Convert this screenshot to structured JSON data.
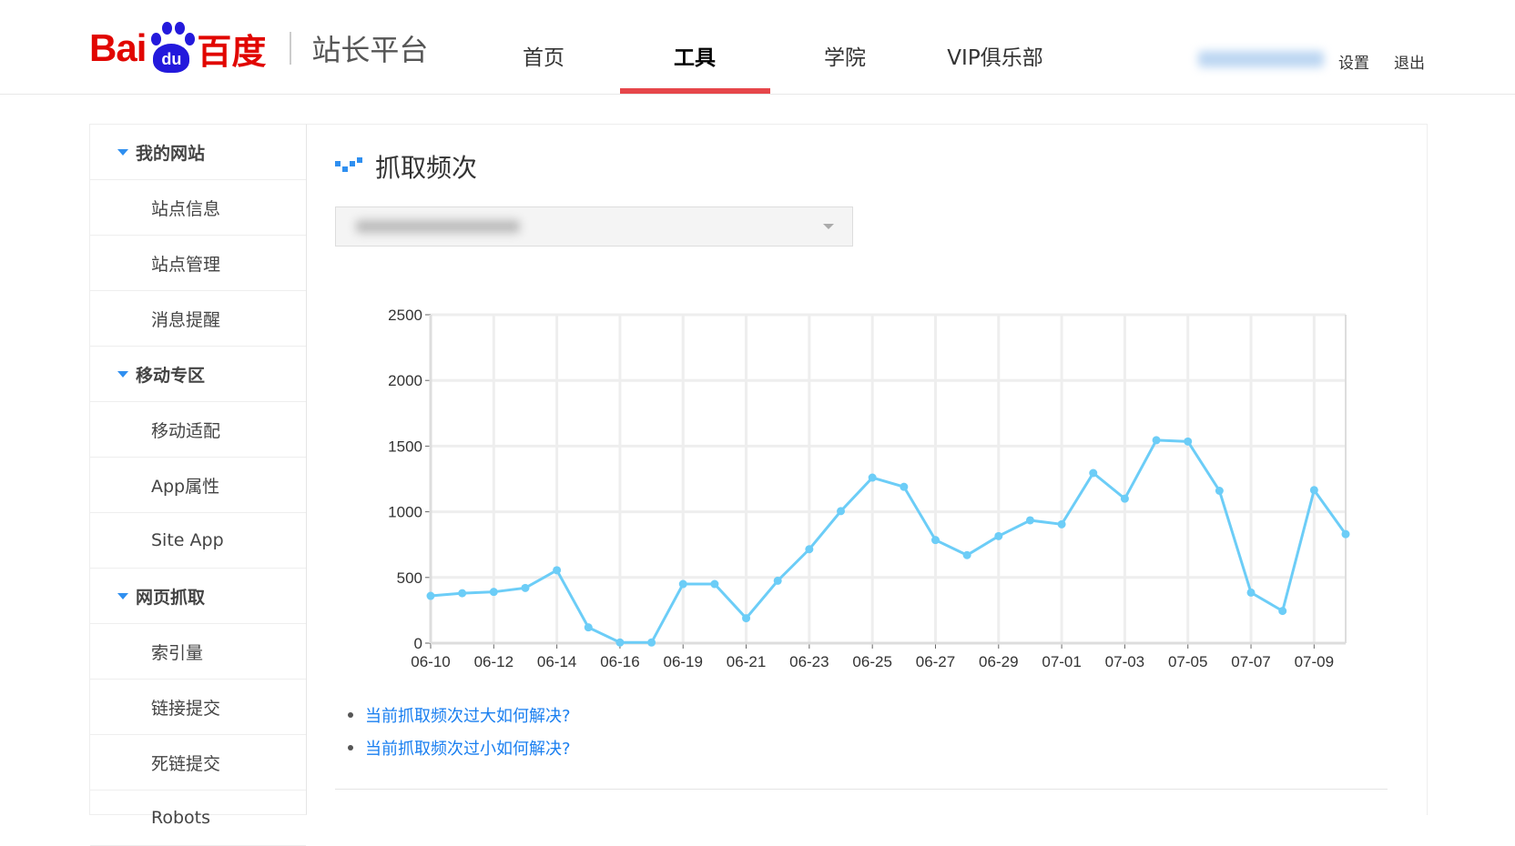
{
  "header": {
    "logo_text": "Bai du 百度",
    "platform": "站长平台",
    "nav": [
      {
        "label": "首页",
        "active": false
      },
      {
        "label": "工具",
        "active": true
      },
      {
        "label": "学院",
        "active": false
      },
      {
        "label": "VIP俱乐部",
        "active": false
      }
    ],
    "settings": "设置",
    "logout": "退出",
    "accent_color": "#e6464a"
  },
  "sidebar": [
    {
      "label": "我的网站",
      "type": "group"
    },
    {
      "label": "站点信息",
      "type": "item"
    },
    {
      "label": "站点管理",
      "type": "item"
    },
    {
      "label": "消息提醒",
      "type": "item"
    },
    {
      "label": "移动专区",
      "type": "group"
    },
    {
      "label": "移动适配",
      "type": "item"
    },
    {
      "label": "App属性",
      "type": "item"
    },
    {
      "label": "Site App",
      "type": "item"
    },
    {
      "label": "网页抓取",
      "type": "group"
    },
    {
      "label": "索引量",
      "type": "item"
    },
    {
      "label": "链接提交",
      "type": "item"
    },
    {
      "label": "死链提交",
      "type": "item"
    },
    {
      "label": "Robots",
      "type": "item"
    }
  ],
  "main": {
    "title": "抓取频次",
    "links": [
      "当前抓取频次过大如何解决?",
      "当前抓取频次过小如何解决?"
    ]
  },
  "chart_data": {
    "type": "line",
    "x": [
      "06-10",
      "06-11",
      "06-12",
      "06-13",
      "06-14",
      "06-15",
      "06-16",
      "06-17",
      "06-19",
      "06-20",
      "06-21",
      "06-22",
      "06-23",
      "06-24",
      "06-25",
      "06-26",
      "06-27",
      "06-28",
      "06-29",
      "06-30",
      "07-01",
      "07-02",
      "07-03",
      "07-04",
      "07-05",
      "07-06",
      "07-07",
      "07-08",
      "07-09",
      "07-10"
    ],
    "x_tick_labels": [
      "06-10",
      "06-12",
      "06-14",
      "06-16",
      "06-19",
      "06-21",
      "06-23",
      "06-25",
      "06-27",
      "06-29",
      "07-01",
      "07-03",
      "07-05",
      "07-07",
      "07-09"
    ],
    "values": [
      360,
      380,
      390,
      420,
      555,
      120,
      5,
      5,
      450,
      450,
      190,
      475,
      715,
      1005,
      1260,
      1190,
      785,
      670,
      815,
      935,
      905,
      1295,
      1100,
      1545,
      1535,
      1160,
      385,
      245,
      1165,
      830
    ],
    "ylim": [
      0,
      2500
    ],
    "y_ticks": [
      "0",
      "500",
      "1000",
      "1500",
      "2000",
      "2500"
    ],
    "grid": true,
    "color": "#6ccdf7"
  }
}
